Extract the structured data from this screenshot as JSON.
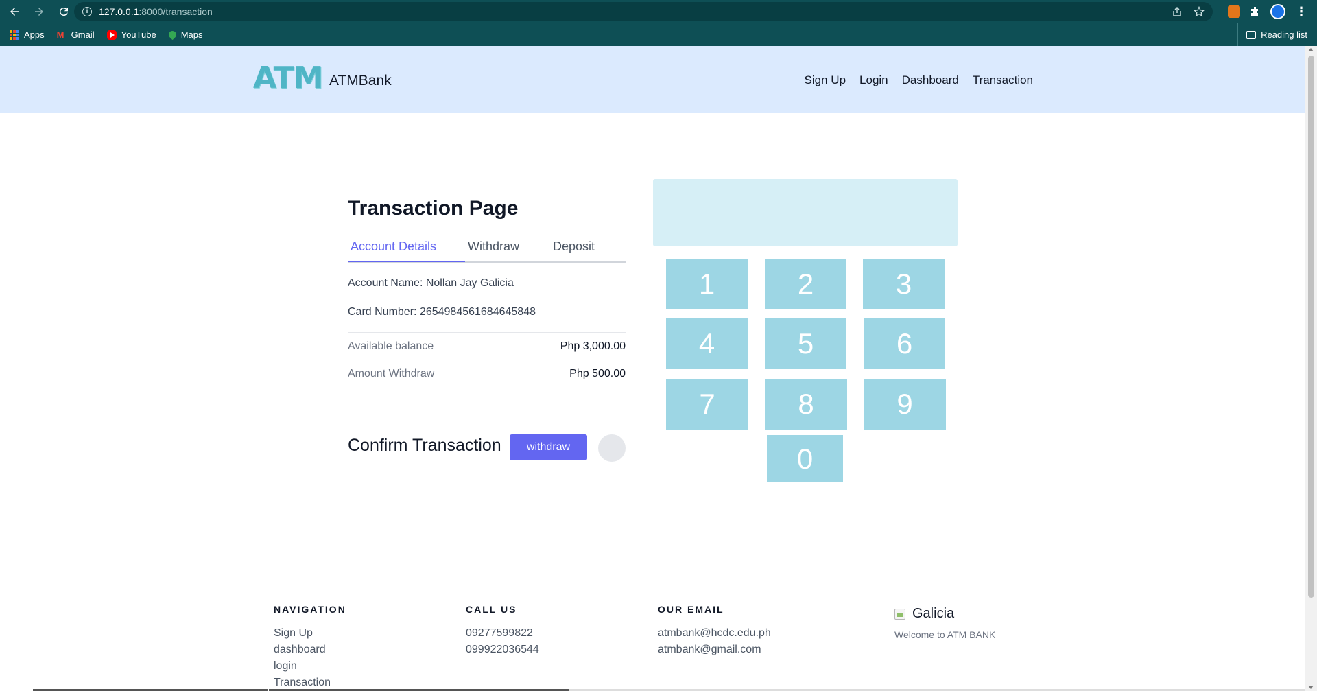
{
  "browser": {
    "url_host": "127.0.0.1",
    "url_path": ":8000/transaction",
    "bookmarks": [
      "Apps",
      "Gmail",
      "YouTube",
      "Maps"
    ],
    "reading_list": "Reading list"
  },
  "header": {
    "logo_text": "ATM",
    "brand": "ATMBank",
    "nav": [
      "Sign Up",
      "Login",
      "Dashboard",
      "Transaction"
    ]
  },
  "transaction": {
    "title": "Transaction Page",
    "tabs": [
      "Account Details",
      "Withdraw",
      "Deposit"
    ],
    "active_tab": "Account Details",
    "account_name": "Account Name: Nollan Jay Galicia",
    "card_number": "Card Number: 2654984561684645848",
    "rows": [
      {
        "label": "Available balance",
        "value": "Php 3,000.00"
      },
      {
        "label": "Amount Withdraw",
        "value": "Php 500.00"
      }
    ],
    "confirm_title": "Confirm Transaction",
    "withdraw_button": "withdraw"
  },
  "keypad": {
    "display": "",
    "keys": [
      "1",
      "2",
      "3",
      "4",
      "5",
      "6",
      "7",
      "8",
      "9",
      "0"
    ]
  },
  "footer": {
    "navigation": {
      "heading": "NAVIGATION",
      "links": [
        "Sign Up",
        "dashboard",
        "login",
        "Transaction"
      ]
    },
    "call_us": {
      "heading": "CALL US",
      "numbers": [
        "09277599822",
        "099922036544"
      ]
    },
    "email": {
      "heading": "OUR EMAIL",
      "addresses": [
        "atmbank@hcdc.edu.ph",
        "atmbank@gmail.com"
      ]
    },
    "brand": {
      "name": "Galicia",
      "tagline": "Welcome to ATM BANK"
    }
  },
  "colors": {
    "chrome": "#0e4f55",
    "header_bg": "#dbeafe",
    "accent": "#6366f1",
    "key_bg": "#9dd6e4",
    "display_bg": "#d6eff6"
  }
}
